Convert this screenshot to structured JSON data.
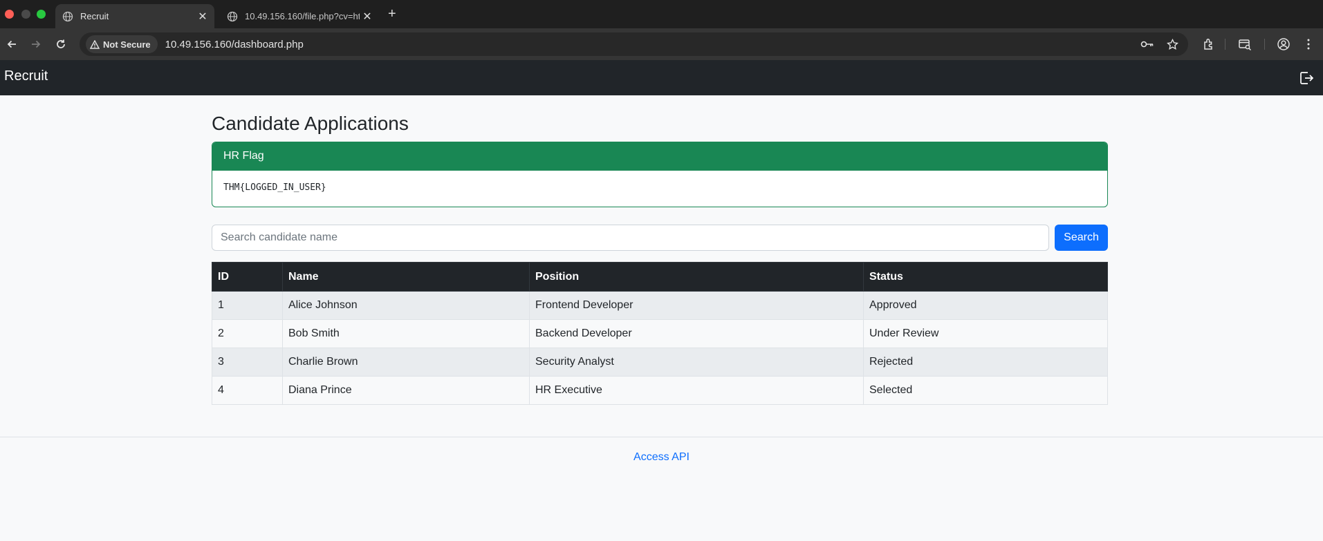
{
  "browser": {
    "tabs": [
      {
        "title": "Recruit"
      },
      {
        "title": "10.49.156.160/file.php?cv=ht"
      }
    ],
    "security_label": "Not Secure",
    "url": "10.49.156.160/dashboard.php"
  },
  "navbar": {
    "brand": "Recruit"
  },
  "page": {
    "title": "Candidate Applications"
  },
  "flag_card": {
    "header": "HR Flag",
    "value": "THM{LOGGED_IN_USER}"
  },
  "search": {
    "placeholder": "Search candidate name",
    "value": "",
    "button_label": "Search"
  },
  "table": {
    "headers": [
      "ID",
      "Name",
      "Position",
      "Status"
    ],
    "rows": [
      [
        "1",
        "Alice Johnson",
        "Frontend Developer",
        "Approved"
      ],
      [
        "2",
        "Bob Smith",
        "Backend Developer",
        "Under Review"
      ],
      [
        "3",
        "Charlie Brown",
        "Security Analyst",
        "Rejected"
      ],
      [
        "4",
        "Diana Prince",
        "HR Executive",
        "Selected"
      ]
    ]
  },
  "footer": {
    "link": "Access API"
  },
  "colors": {
    "navbar": "#212529",
    "success": "#198754",
    "primary": "#0d6efd"
  }
}
